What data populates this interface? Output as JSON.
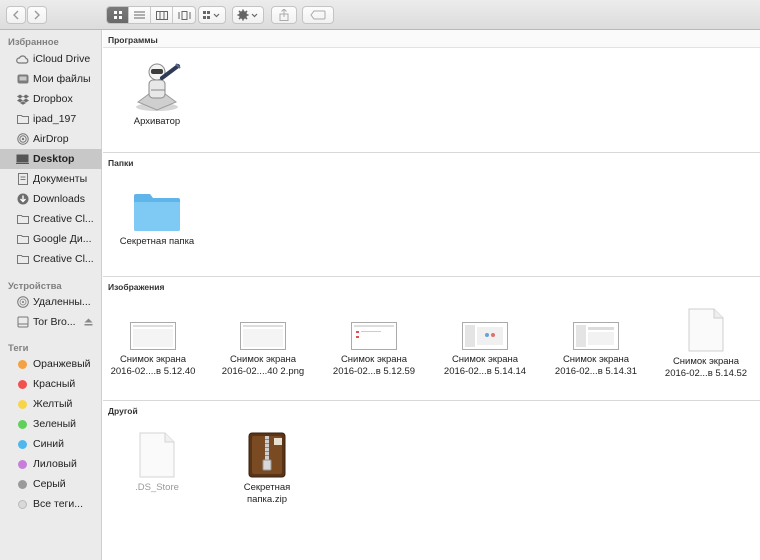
{
  "toolbar": {
    "back_icon": "chevron-left-icon",
    "forward_icon": "chevron-right-icon",
    "view_modes": [
      "icon-view-icon",
      "list-view-icon",
      "column-view-icon",
      "coverflow-view-icon"
    ],
    "arrange_icon": "arrange-grid-icon",
    "action_icon": "gear-icon",
    "share_icon": "share-icon",
    "tag_icon": "tag-icon"
  },
  "sidebar": {
    "favorites_header": "Избранное",
    "devices_header": "Устройства",
    "tags_header": "Теги",
    "favorites": [
      {
        "label": "iCloud Drive",
        "icon": "cloud-icon"
      },
      {
        "label": "Мои файлы",
        "icon": "all-files-icon"
      },
      {
        "label": "Dropbox",
        "icon": "dropbox-icon"
      },
      {
        "label": "ipad_197",
        "icon": "folder-icon"
      },
      {
        "label": "AirDrop",
        "icon": "airdrop-icon"
      },
      {
        "label": "Desktop",
        "icon": "desktop-icon",
        "selected": true
      },
      {
        "label": "Документы",
        "icon": "documents-icon"
      },
      {
        "label": "Downloads",
        "icon": "downloads-icon"
      },
      {
        "label": "Creative Cl...",
        "icon": "folder-icon"
      },
      {
        "label": "Google Ди...",
        "icon": "folder-icon"
      },
      {
        "label": "Creative Cl...",
        "icon": "folder-icon"
      }
    ],
    "devices": [
      {
        "label": "Удаленны...",
        "icon": "remote-disc-icon"
      },
      {
        "label": "Tor Bro...",
        "icon": "disk-icon"
      }
    ],
    "tags": [
      {
        "label": "Оранжевый",
        "color": "#f5a142"
      },
      {
        "label": "Красный",
        "color": "#f0524f"
      },
      {
        "label": "Желтый",
        "color": "#f7d548"
      },
      {
        "label": "Зеленый",
        "color": "#5fd15a"
      },
      {
        "label": "Синий",
        "color": "#4fb6ee"
      },
      {
        "label": "Лиловый",
        "color": "#c67fd9"
      },
      {
        "label": "Серый",
        "color": "#9a9a9a"
      },
      {
        "label": "Все теги...",
        "color": "#d9d9d9"
      }
    ]
  },
  "main": {
    "sections": {
      "apps": {
        "title": "Программы",
        "items": [
          {
            "line1": "Архиватор",
            "icon": "archive-utility-icon"
          }
        ]
      },
      "folders": {
        "title": "Папки",
        "items": [
          {
            "line1": "Секретная папка",
            "icon": "folder-icon"
          }
        ]
      },
      "images": {
        "title": "Изображения",
        "items": [
          {
            "line1": "Снимок экрана",
            "line2": "2016-02....в 5.12.40",
            "icon": "screenshot-thumbnail-icon"
          },
          {
            "line1": "Снимок экрана",
            "line2": "2016-02....40 2.png",
            "icon": "screenshot-thumbnail-icon"
          },
          {
            "line1": "Снимок экрана",
            "line2": "2016-02...в 5.12.59",
            "icon": "screenshot-thumbnail-icon"
          },
          {
            "line1": "Снимок экрана",
            "line2": "2016-02...в 5.14.14",
            "icon": "screenshot-thumbnail-icon"
          },
          {
            "line1": "Снимок экрана",
            "line2": "2016-02...в 5.14.31",
            "icon": "screenshot-thumbnail-icon"
          },
          {
            "line1": "Снимок экрана",
            "line2": "2016-02...в 5.14.52",
            "icon": "blank-document-icon"
          }
        ]
      },
      "other": {
        "title": "Другой",
        "items": [
          {
            "line1": ".DS_Store",
            "icon": "blank-document-icon"
          },
          {
            "line1": "Секретная",
            "line2": "папка.zip",
            "icon": "zip-archive-icon"
          }
        ]
      }
    }
  }
}
